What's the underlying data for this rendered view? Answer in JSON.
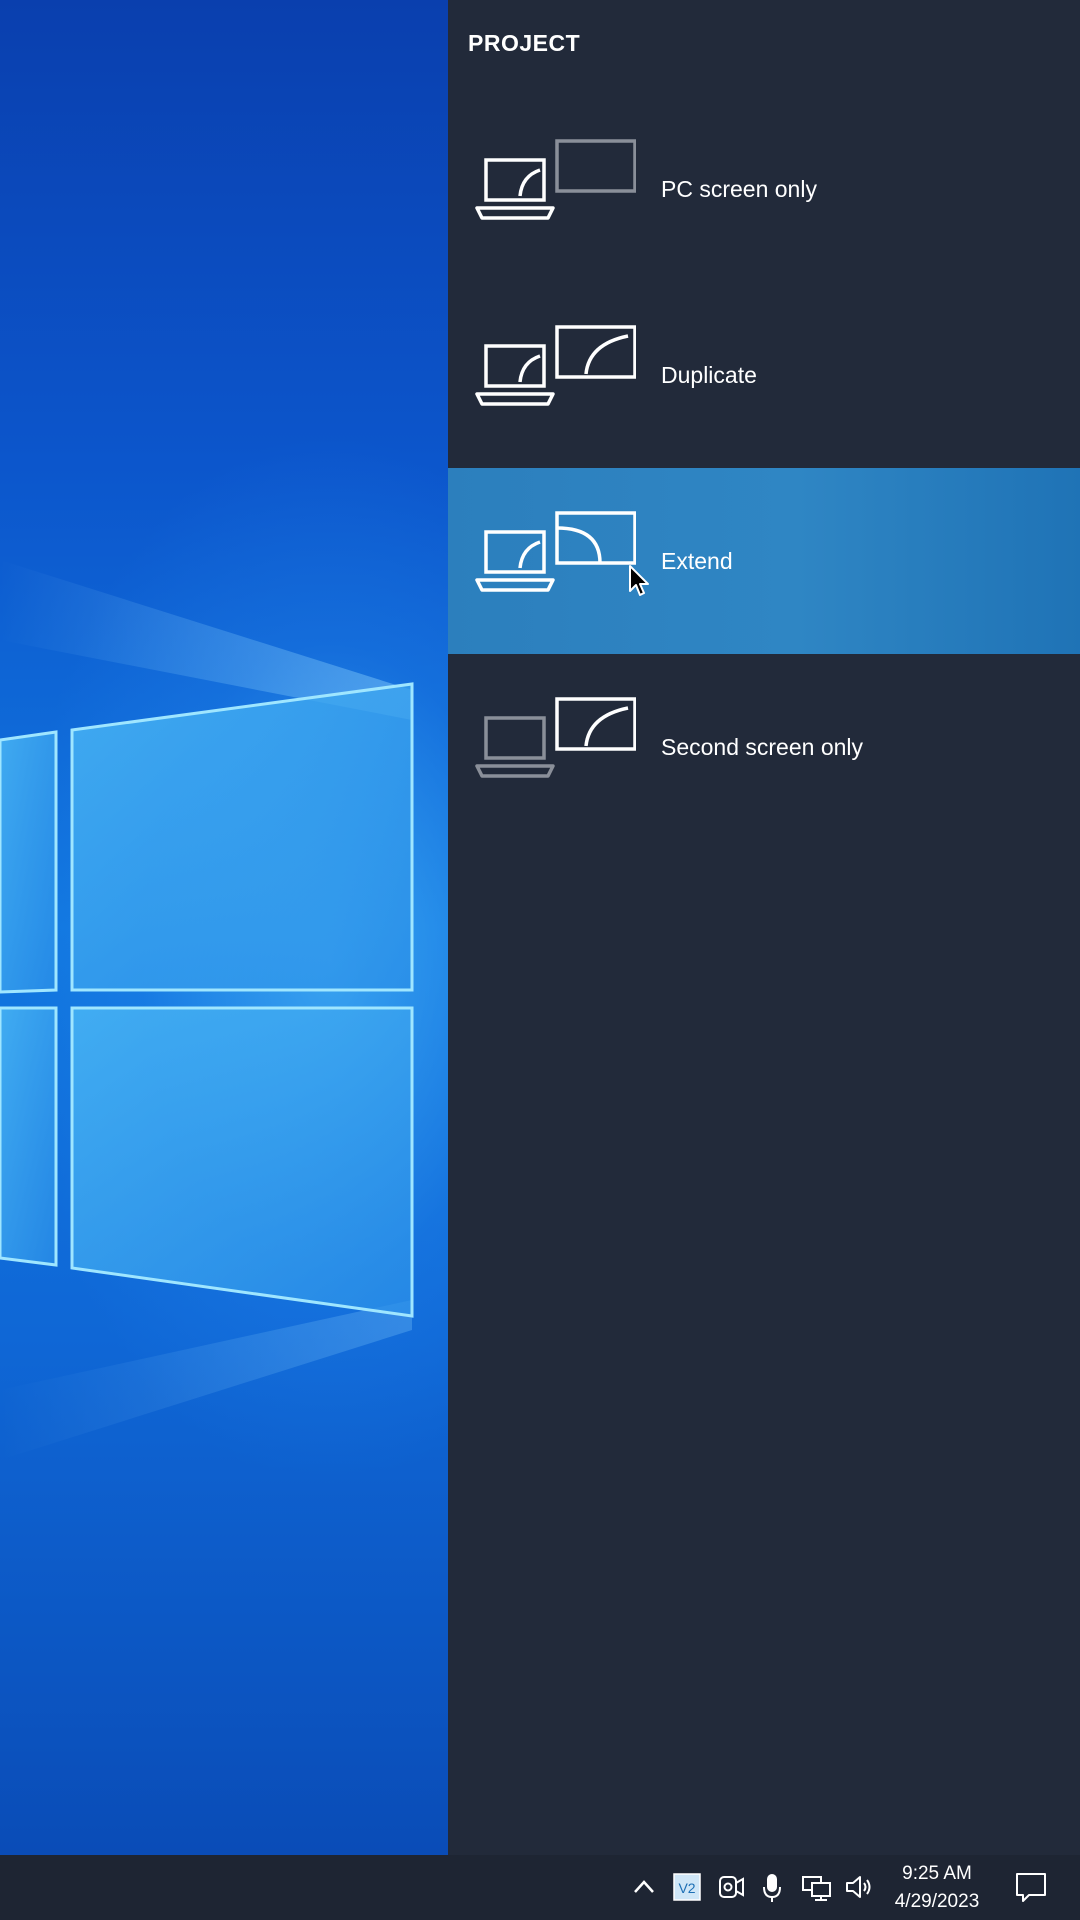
{
  "panel": {
    "title": "PROJECT",
    "options": [
      {
        "label": "PC screen only",
        "icon": "pc-screen-only-icon"
      },
      {
        "label": "Duplicate",
        "icon": "duplicate-icon"
      },
      {
        "label": "Extend",
        "icon": "extend-icon",
        "selected": true
      },
      {
        "label": "Second screen only",
        "icon": "second-screen-only-icon"
      }
    ]
  },
  "taskbar": {
    "time": "9:25 AM",
    "date": "4/29/2023",
    "tray_icons": [
      "chevron-up-icon",
      "app-v2-icon",
      "camera-icon",
      "microphone-icon",
      "network-icon",
      "volume-icon",
      "notification-icon"
    ]
  },
  "colors": {
    "panel_bg": "#222a3a",
    "selected_bg": "#2c7fbd",
    "taskbar_bg": "#1e2533",
    "dim_icon": "#8a8f99"
  }
}
